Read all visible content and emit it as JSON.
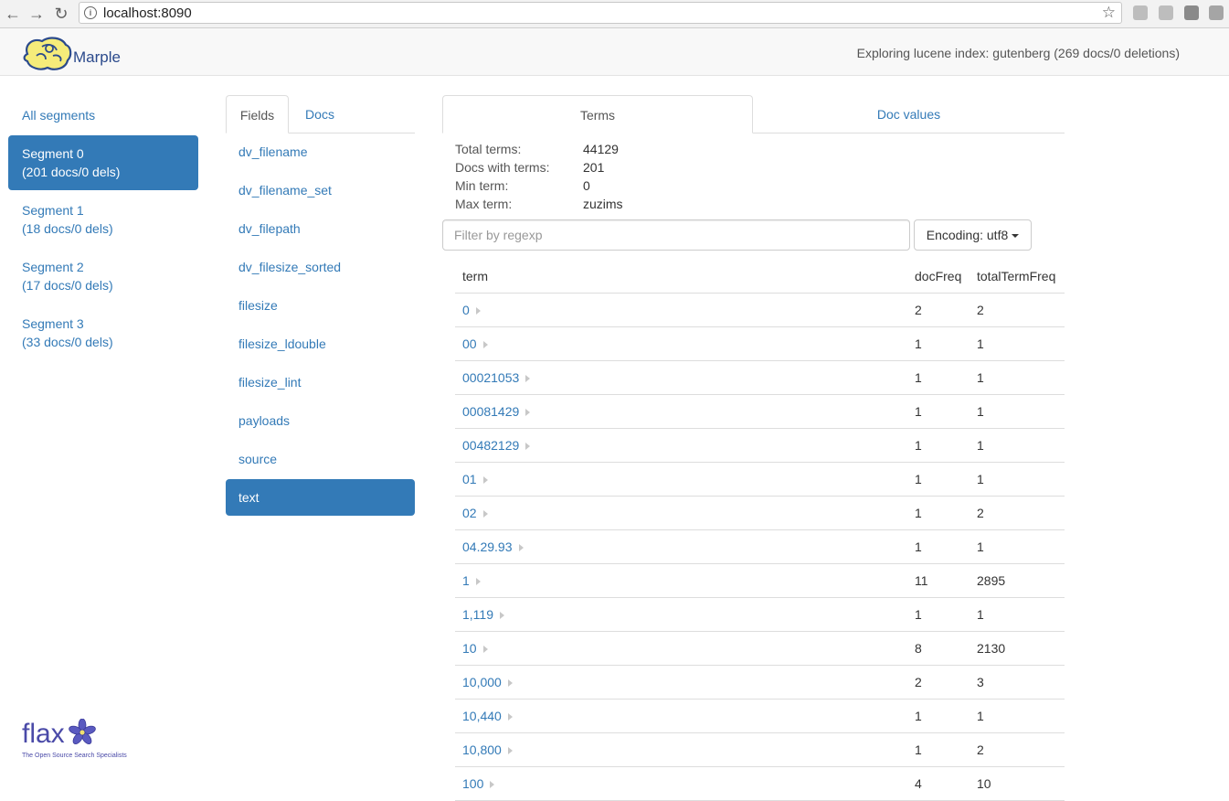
{
  "browser": {
    "url": "localhost:8090",
    "back_icon": "arrow-left-icon",
    "forward_icon": "arrow-right-icon",
    "reload_icon": "reload-icon",
    "bookmark_icon": "star-icon"
  },
  "app": {
    "brand": "Marple",
    "index_info": "Exploring lucene index: gutenberg (269 docs/0 deletions)"
  },
  "segments": [
    {
      "name": "All segments",
      "detail": ""
    },
    {
      "name": "Segment 0",
      "detail": "(201 docs/0 dels)"
    },
    {
      "name": "Segment 1",
      "detail": "(18 docs/0 dels)"
    },
    {
      "name": "Segment 2",
      "detail": "(17 docs/0 dels)"
    },
    {
      "name": "Segment 3",
      "detail": "(33 docs/0 dels)"
    }
  ],
  "left_tabs": {
    "fields": "Fields",
    "docs": "Docs"
  },
  "fields": [
    "dv_filename",
    "dv_filename_set",
    "dv_filepath",
    "dv_filesize_sorted",
    "filesize",
    "filesize_ldouble",
    "filesize_lint",
    "payloads",
    "source",
    "text"
  ],
  "right_tabs": {
    "terms": "Terms",
    "doc_values": "Doc values"
  },
  "stats": {
    "total_terms_label": "Total terms:",
    "total_terms": "44129",
    "docs_with_terms_label": "Docs with terms:",
    "docs_with_terms": "201",
    "min_term_label": "Min term:",
    "min_term": "0",
    "max_term_label": "Max term:",
    "max_term": "zuzims"
  },
  "filter": {
    "placeholder": "Filter by regexp",
    "value": ""
  },
  "encoding": {
    "label": "Encoding: utf8"
  },
  "table": {
    "headers": {
      "term": "term",
      "doc_freq": "docFreq",
      "total_term_freq": "totalTermFreq"
    },
    "rows": [
      {
        "term": "0",
        "docFreq": "2",
        "totalTermFreq": "2"
      },
      {
        "term": "00",
        "docFreq": "1",
        "totalTermFreq": "1"
      },
      {
        "term": "00021053",
        "docFreq": "1",
        "totalTermFreq": "1"
      },
      {
        "term": "00081429",
        "docFreq": "1",
        "totalTermFreq": "1"
      },
      {
        "term": "00482129",
        "docFreq": "1",
        "totalTermFreq": "1"
      },
      {
        "term": "01",
        "docFreq": "1",
        "totalTermFreq": "1"
      },
      {
        "term": "02",
        "docFreq": "1",
        "totalTermFreq": "2"
      },
      {
        "term": "04.29.93",
        "docFreq": "1",
        "totalTermFreq": "1"
      },
      {
        "term": "1",
        "docFreq": "11",
        "totalTermFreq": "2895"
      },
      {
        "term": "1,119",
        "docFreq": "1",
        "totalTermFreq": "1"
      },
      {
        "term": "10",
        "docFreq": "8",
        "totalTermFreq": "2130"
      },
      {
        "term": "10,000",
        "docFreq": "2",
        "totalTermFreq": "3"
      },
      {
        "term": "10,440",
        "docFreq": "1",
        "totalTermFreq": "1"
      },
      {
        "term": "10,800",
        "docFreq": "1",
        "totalTermFreq": "2"
      },
      {
        "term": "100",
        "docFreq": "4",
        "totalTermFreq": "10"
      }
    ]
  },
  "footer": {
    "logo_word": "flax",
    "tagline": "The Open Source Search Specialists"
  },
  "colors": {
    "accent": "#337ab7",
    "brand": "#2b4a8c"
  }
}
